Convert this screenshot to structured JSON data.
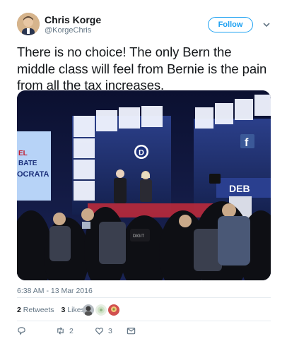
{
  "user": {
    "name": "Chris Korge",
    "handle": "@KorgeChris"
  },
  "follow_label": "Follow",
  "tweet": {
    "text": "There is no choice! The only Bern the middle class will feel from Bernie is the pain from all the tax increases.",
    "timestamp": "6:38 AM - 13 Mar 2016"
  },
  "media": {
    "screen_left_lines": [
      "EL",
      "BATE",
      "OCRATA"
    ],
    "screen_right_text": "DEB",
    "facebook_letter": "f",
    "podium_letter": "D",
    "camera_label": "DIGIT"
  },
  "stats": {
    "retweets_count": "2",
    "retweets_label": "Retweets",
    "likes_count": "3",
    "likes_label": "Likes"
  },
  "actions": {
    "reply_icon": "reply-icon",
    "retweet_count": "2",
    "like_count": "3",
    "message_icon": "message-icon"
  },
  "colors": {
    "accent": "#1da1f2",
    "muted": "#657786",
    "text": "#14171a",
    "divider": "#e6ecf0"
  }
}
